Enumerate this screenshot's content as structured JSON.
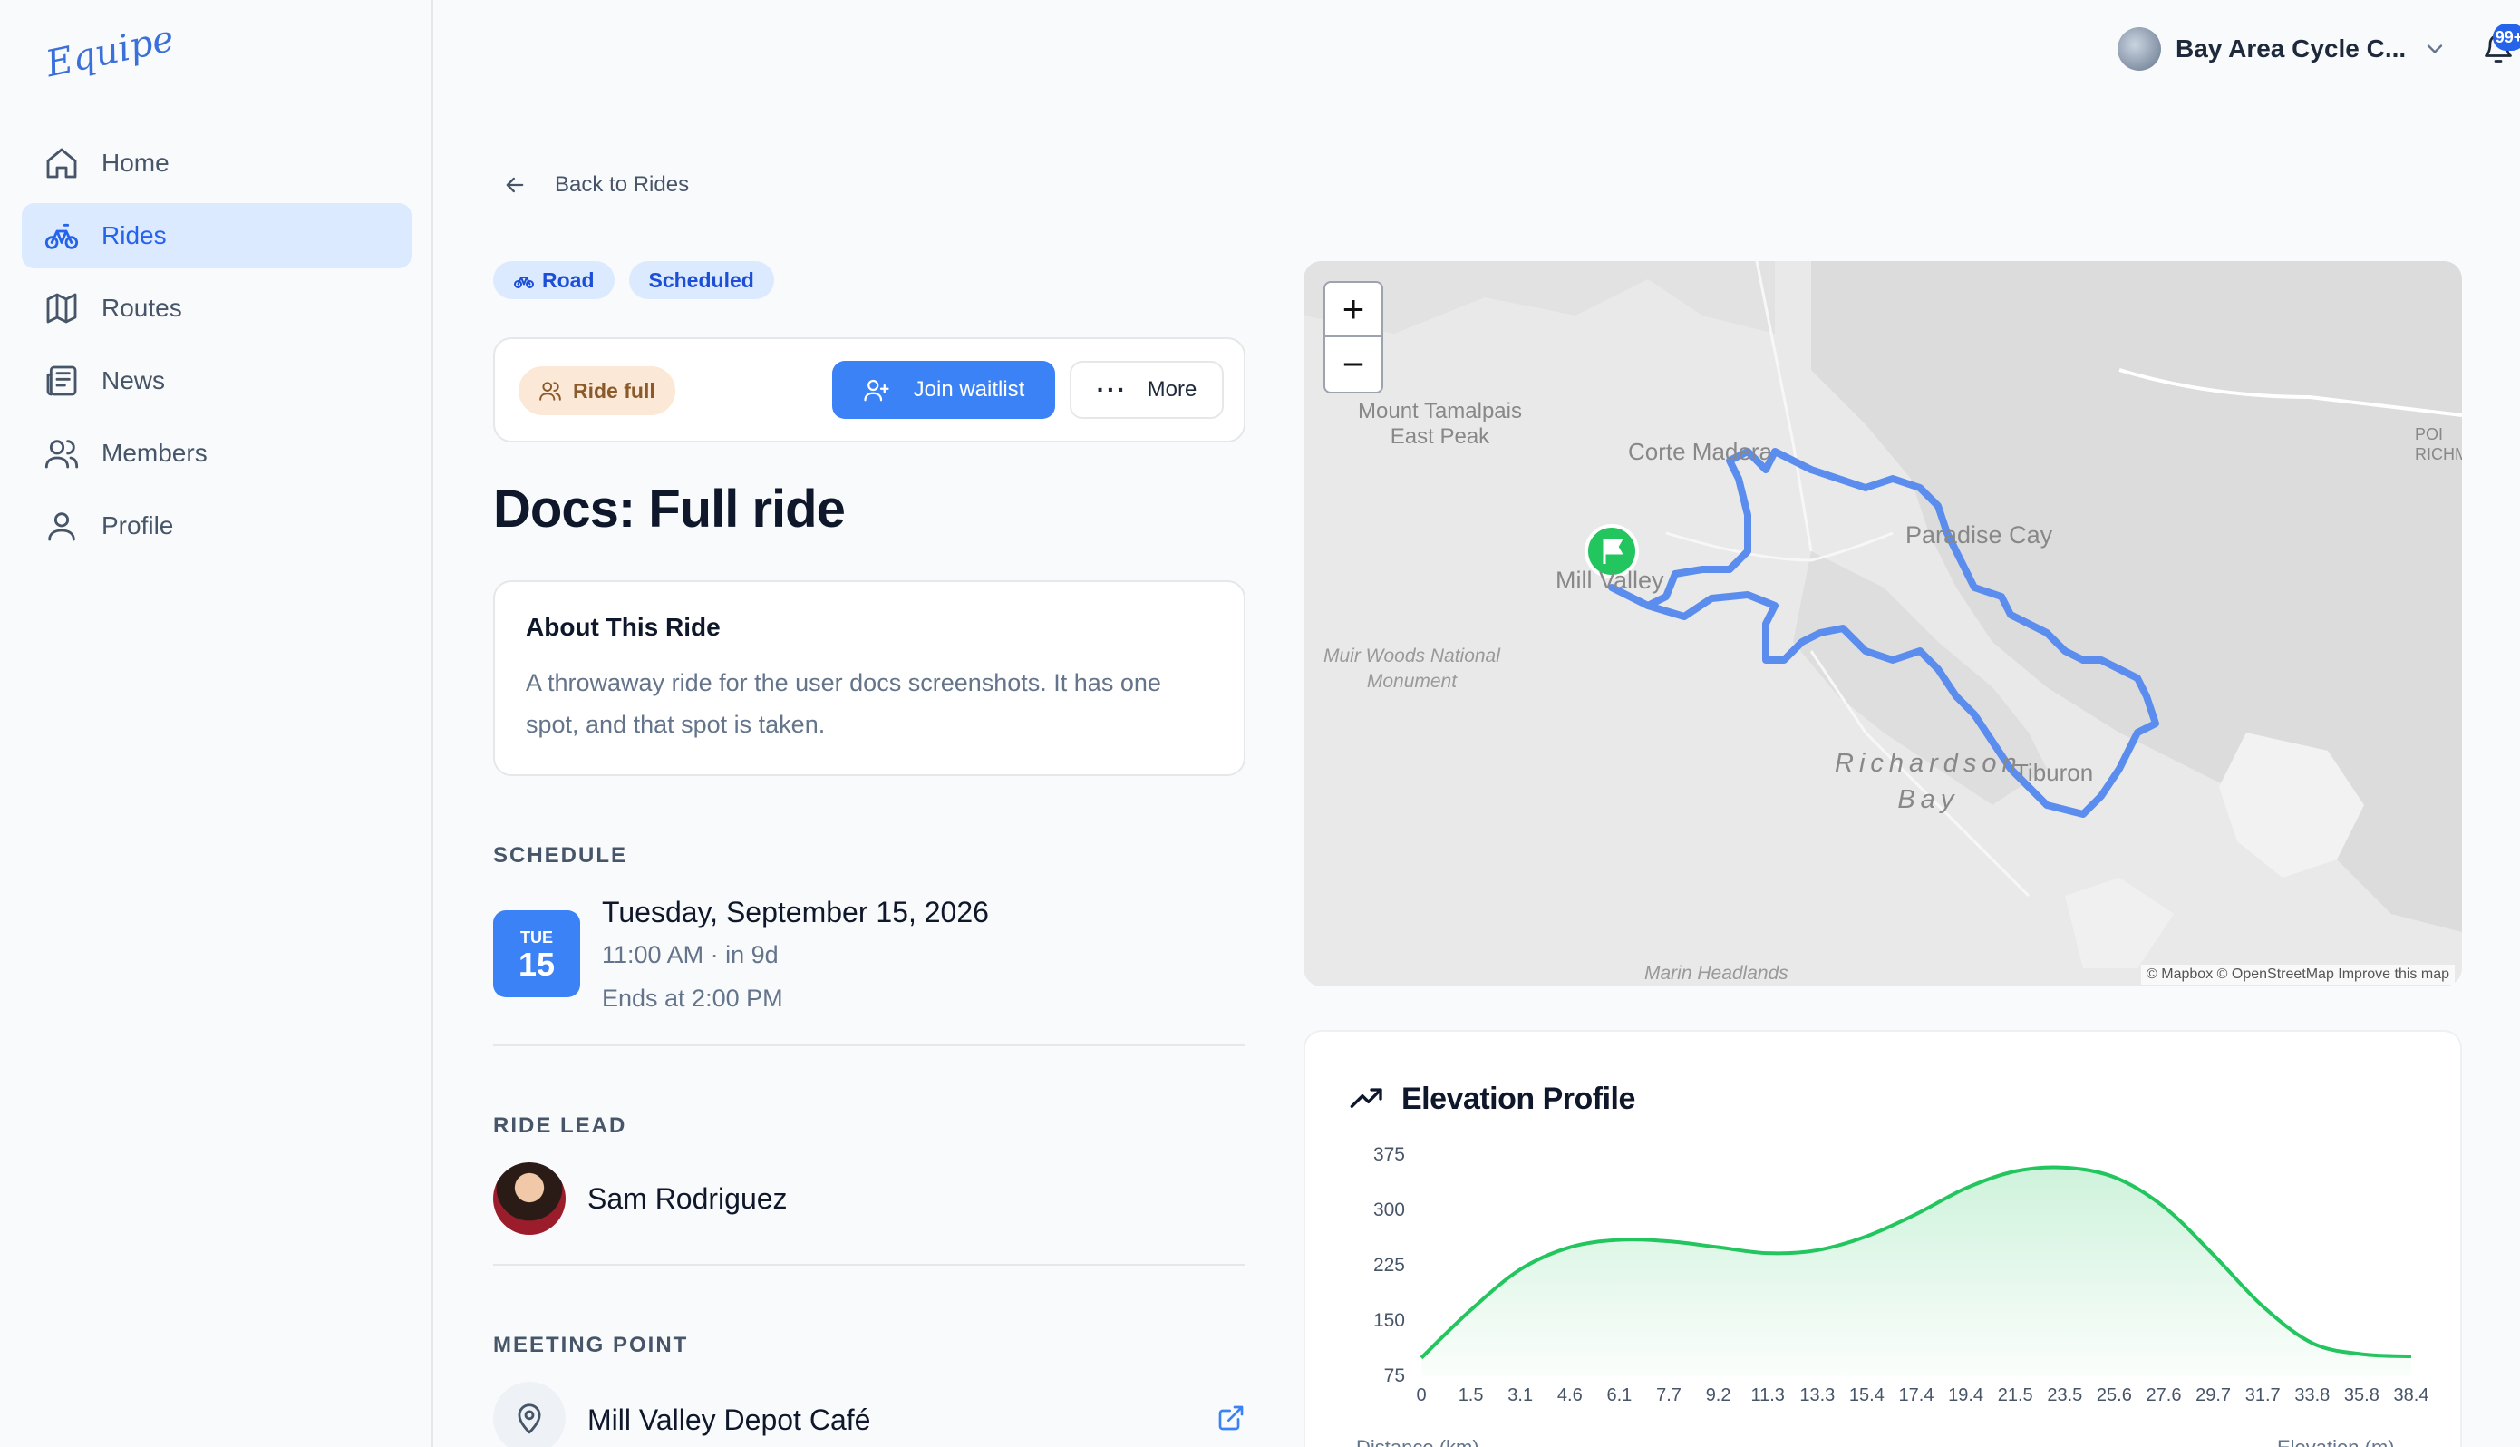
{
  "app": {
    "logo_text": "Equipe"
  },
  "sidebar": {
    "items": [
      {
        "label": "Home",
        "icon": "home-icon",
        "active": false
      },
      {
        "label": "Rides",
        "icon": "bike-icon",
        "active": true
      },
      {
        "label": "Routes",
        "icon": "map-icon",
        "active": false
      },
      {
        "label": "News",
        "icon": "newspaper-icon",
        "active": false
      },
      {
        "label": "Members",
        "icon": "users-icon",
        "active": false
      },
      {
        "label": "Profile",
        "icon": "user-icon",
        "active": false
      }
    ]
  },
  "topbar": {
    "club_name": "Bay Area Cycle C...",
    "notification_count": "99+"
  },
  "page": {
    "back_label": "Back to Rides",
    "tags": [
      "Road",
      "Scheduled"
    ],
    "status_pill": "Ride full",
    "join_label": "Join waitlist",
    "more_label": "More",
    "title": "Docs: Full ride",
    "about": {
      "heading": "About This Ride",
      "text": "A throwaway ride for the user docs screenshots. It has one spot, and that spot is taken."
    },
    "schedule": {
      "label": "SCHEDULE",
      "dow": "TUE",
      "day": "15",
      "date": "Tuesday, September 15, 2026",
      "time": "11:00 AM · in 9d",
      "ends": "Ends at 2:00 PM"
    },
    "ride_lead": {
      "label": "RIDE LEAD",
      "name": "Sam Rodriguez"
    },
    "meeting_point": {
      "label": "MEETING POINT",
      "name": "Mill Valley Depot Café"
    }
  },
  "map": {
    "zoom_in": "+",
    "zoom_out": "−",
    "labels": {
      "peak": "Mount Tamalpais\nEast Peak",
      "corte": "Corte Madera",
      "paradise": "Paradise Cay",
      "mill": "Mill Valley",
      "muir": "Muir Woods National\nMonument",
      "richardson": "Richardson\nBay",
      "tiburon": "Tiburon",
      "headlands": "Marin Headlands",
      "point": "POI\nRICHM"
    },
    "attribution": "© Mapbox © OpenStreetMap Improve this map",
    "route_color": "#5b8def"
  },
  "chart_data": {
    "type": "area",
    "title": "Elevation Profile",
    "xlabel": "Distance (km)",
    "ylabel": "Elevation (m)",
    "ylim": [
      75,
      375
    ],
    "yticks": [
      "375",
      "300",
      "225",
      "150",
      "75"
    ],
    "x_tick_labels": [
      "0",
      "1.5",
      "3.1",
      "4.6",
      "6.1",
      "7.7",
      "9.2",
      "11.3",
      "13.3",
      "15.4",
      "17.4",
      "19.4",
      "21.5",
      "23.5",
      "25.6",
      "27.6",
      "29.7",
      "31.7",
      "33.8",
      "35.8",
      "38.4"
    ],
    "series": [
      {
        "x": [
          0,
          1.5,
          3.1,
          4.6,
          6.1,
          7.7,
          9.2,
          11.3,
          13.3,
          15.4,
          17.4,
          19.4,
          21.5,
          23.5,
          25.6,
          27.6,
          29.7,
          31.7,
          33.8,
          35.8,
          38.4
        ],
        "values": [
          100,
          165,
          220,
          250,
          260,
          258,
          250,
          242,
          246,
          265,
          295,
          330,
          353,
          358,
          345,
          305,
          240,
          170,
          120,
          105,
          102
        ]
      }
    ],
    "color": "#22c55e"
  }
}
